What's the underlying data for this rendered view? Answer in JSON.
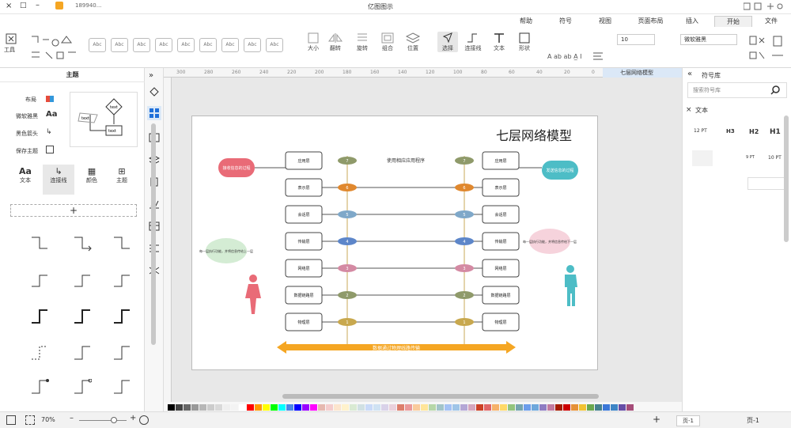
{
  "window": {
    "title": "亿图图示",
    "user": "189940...",
    "controls": [
      "-",
      "□",
      "×"
    ]
  },
  "menu": {
    "tabs": [
      {
        "label": "文件",
        "active": false
      },
      {
        "label": "开始",
        "active": true
      },
      {
        "label": "插入",
        "active": false
      },
      {
        "label": "页面布局",
        "active": false
      },
      {
        "label": "视图",
        "active": false
      },
      {
        "label": "符号",
        "active": false
      },
      {
        "label": "帮助",
        "active": false
      }
    ]
  },
  "ribbon": {
    "font_name": "微软雅黑",
    "font_size": "10",
    "tools_label": "工具",
    "select_label": "选择",
    "connector_label": "连接线",
    "text_label": "文本",
    "shape_label": "形状",
    "style_placeholder": "Abc",
    "position_label": "位置",
    "align_label": "对齐",
    "size_label": "大小",
    "group_label": "组合",
    "rotate_label": "旋转",
    "flip_label": "翻转"
  },
  "left_panel": {
    "title": "主题",
    "items": [
      "主题",
      "颜色",
      "连接线",
      "文本"
    ],
    "theme_opts": [
      "布局",
      "微软雅黑",
      "黑色箭头",
      "保存主题"
    ],
    "add_label": "+"
  },
  "canvas": {
    "doc_tab": "七层网络模型",
    "ruler_labels": [
      "300",
      "280",
      "260",
      "240",
      "220",
      "200",
      "180",
      "160",
      "140",
      "120",
      "100",
      "80",
      "60",
      "40",
      "20",
      "0"
    ],
    "diagram_title": "七层网络模型",
    "left_layers": [
      "应用层",
      "表示层",
      "会话层",
      "传输层",
      "网络层",
      "数据链路层",
      "物理层"
    ],
    "right_layers": [
      "应用层",
      "表示层",
      "会话层",
      "传输层",
      "网络层",
      "数据链路层",
      "物理层"
    ],
    "numbers": [
      "7",
      "6",
      "5",
      "4",
      "3",
      "2",
      "1"
    ],
    "top_note": "使用相应应用程序",
    "bottom_arrow": "数据通过物理线路传输",
    "left_bubble_top": "接收信息的过程",
    "right_bubble_top": "发送信息的过程",
    "left_cloud": "每一层执行功能，并将信息传给上一层",
    "right_cloud": "每一层执行功能，并将信息传给下一层"
  },
  "right_panel": {
    "title": "符号库",
    "search_placeholder": "搜索符号库",
    "section": "文本",
    "headings": [
      "H1",
      "H2",
      "H3",
      "12 PT",
      "10 PT",
      "9 PT"
    ]
  },
  "status": {
    "page_label": "页-1",
    "page_tab": "页-1",
    "zoom": "70%",
    "colors": [
      "#000000",
      "#434343",
      "#666666",
      "#999999",
      "#b7b7b7",
      "#cccccc",
      "#d9d9d9",
      "#efefef",
      "#f3f3f3",
      "#ffffff",
      "#ff0000",
      "#ff9900",
      "#ffff00",
      "#00ff00",
      "#00ffff",
      "#4a86e8",
      "#0000ff",
      "#9900ff",
      "#ff00ff",
      "#e6b8af",
      "#f4cccc",
      "#fce5cd",
      "#fff2cc",
      "#d9ead3",
      "#d0e0e3",
      "#c9daf8",
      "#cfe2f3",
      "#d9d2e9",
      "#ead1dc",
      "#dd7e6b",
      "#ea9999",
      "#f9cb9c",
      "#ffe599",
      "#b6d7a8",
      "#a2c4c9",
      "#a4c2f4",
      "#9fc5e8",
      "#b4a7d6",
      "#d5a6bd",
      "#cc4125",
      "#e06666",
      "#f6b26b",
      "#ffd966",
      "#93c47d",
      "#76a5af",
      "#6d9eeb",
      "#6fa8dc",
      "#8e7cc3",
      "#c27ba0",
      "#a61c00",
      "#cc0000",
      "#e69138",
      "#f1c232",
      "#6aa84f",
      "#45818e",
      "#3c78d8",
      "#3d85c6",
      "#674ea7",
      "#a64d79"
    ]
  }
}
